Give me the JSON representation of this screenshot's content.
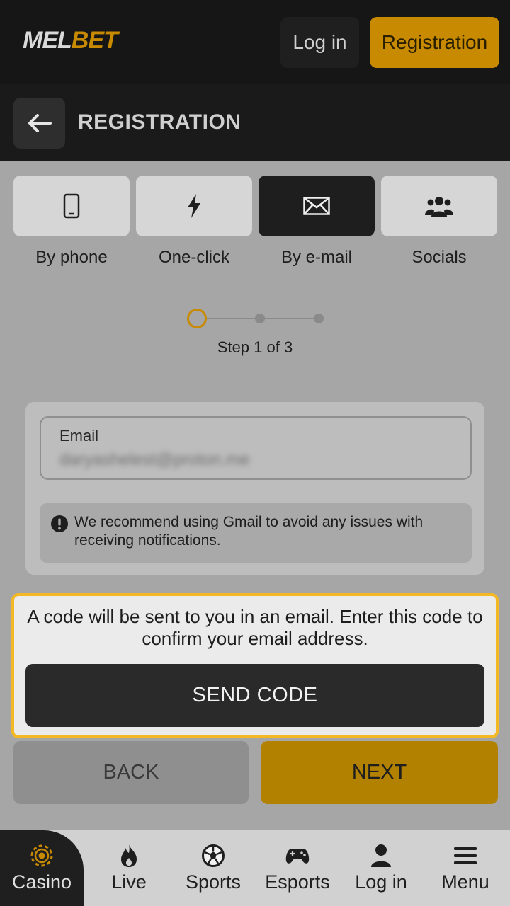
{
  "header": {
    "logo_mel": "MEL",
    "logo_bet": "BET",
    "login_label": "Log in",
    "registration_label": "Registration"
  },
  "titlebar": {
    "back_icon": "arrow-left-icon",
    "title": "REGISTRATION"
  },
  "tabs": [
    {
      "label": "By phone",
      "icon": "phone-icon",
      "active": false
    },
    {
      "label": "One-click",
      "icon": "lightning-icon",
      "active": false
    },
    {
      "label": "By e-mail",
      "icon": "envelope-icon",
      "active": true
    },
    {
      "label": "Socials",
      "icon": "people-icon",
      "active": false
    }
  ],
  "stepper": {
    "current": 1,
    "total": 3,
    "text": "Step 1 of 3"
  },
  "email": {
    "label": "Email",
    "value": "daryashelest@proton.me"
  },
  "notice": {
    "icon": "exclamation-icon",
    "text": "We recommend using Gmail to avoid any issues with receiving notifications."
  },
  "code": {
    "text": "A code will be sent to you in an email. Enter this code to confirm your email address.",
    "send_label": "SEND CODE"
  },
  "actions": {
    "back_label": "BACK",
    "next_label": "NEXT"
  },
  "bottom_nav": [
    {
      "label": "Casino",
      "icon": "casino-chip-icon",
      "active": true
    },
    {
      "label": "Live",
      "icon": "flame-icon",
      "active": false
    },
    {
      "label": "Sports",
      "icon": "soccer-ball-icon",
      "active": false
    },
    {
      "label": "Esports",
      "icon": "gamepad-icon",
      "active": false
    },
    {
      "label": "Log in",
      "icon": "user-icon",
      "active": false
    },
    {
      "label": "Menu",
      "icon": "menu-icon",
      "active": false
    }
  ],
  "colors": {
    "brand": "#c88a00",
    "highlight_border": "#f3b823",
    "header_bg": "#161616"
  }
}
